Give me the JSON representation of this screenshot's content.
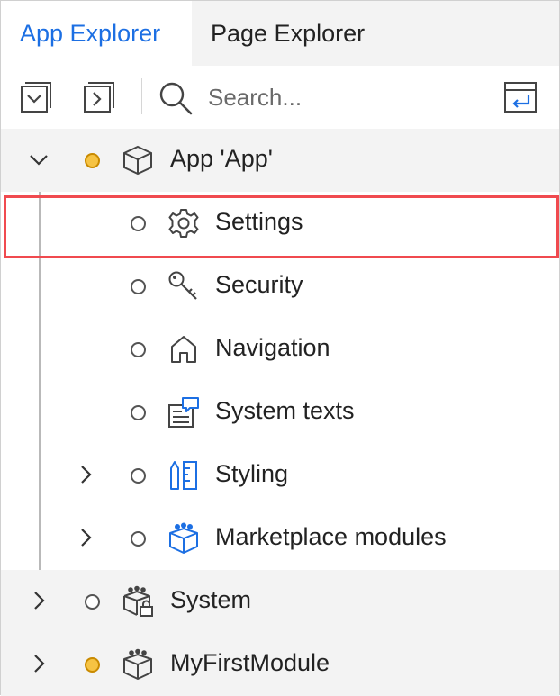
{
  "tabs": [
    {
      "label": "App Explorer",
      "active": true
    },
    {
      "label": "Page Explorer",
      "active": false
    }
  ],
  "toolbar": {
    "search_placeholder": "Search...",
    "collapse_all_icon": "collapse-all-icon",
    "expand_all_icon": "expand-all-icon",
    "link_editor_icon": "link-editor-icon"
  },
  "tree": {
    "app": {
      "label": "App 'App'",
      "expanded": true,
      "status": "modified"
    },
    "app_children": [
      {
        "label": "Settings",
        "icon": "gear-icon",
        "expandable": false,
        "selected": true
      },
      {
        "label": "Security",
        "icon": "key-icon",
        "expandable": false
      },
      {
        "label": "Navigation",
        "icon": "home-icon",
        "expandable": false
      },
      {
        "label": "System texts",
        "icon": "system-texts-icon",
        "expandable": false
      },
      {
        "label": "Styling",
        "icon": "styling-icon",
        "expandable": true
      },
      {
        "label": "Marketplace modules",
        "icon": "marketplace-modules-icon",
        "expandable": true
      }
    ],
    "modules": [
      {
        "label": "System",
        "icon": "locked-module-icon",
        "status": "normal"
      },
      {
        "label": "MyFirstModule",
        "icon": "module-icon",
        "status": "modified"
      }
    ]
  },
  "colors": {
    "accent": "#1c6fe3",
    "selection_outline": "#f04a4f",
    "modified_dot": "#f6c343",
    "group_background": "#f3f3f3"
  }
}
